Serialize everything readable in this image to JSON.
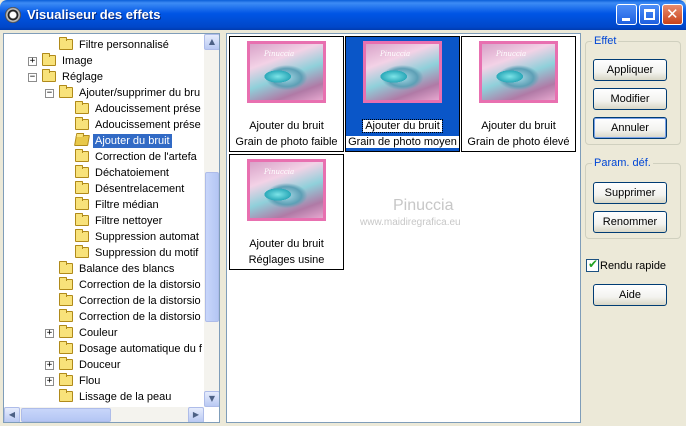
{
  "window": {
    "title": "Visualiseur des effets"
  },
  "tree": {
    "items": [
      {
        "label": "Filtre personnalisé",
        "level": 2,
        "expander": "",
        "open": false,
        "selected": false
      },
      {
        "label": "Image",
        "level": 1,
        "expander": "+",
        "open": false,
        "selected": false
      },
      {
        "label": "Réglage",
        "level": 1,
        "expander": "−",
        "open": true,
        "selected": false
      },
      {
        "label": "Ajouter/supprimer du bru",
        "level": 2,
        "expander": "−",
        "open": true,
        "selected": false
      },
      {
        "label": "Adoucissement prése",
        "level": 3,
        "expander": "",
        "open": false,
        "selected": false
      },
      {
        "label": "Adoucissement prése",
        "level": 3,
        "expander": "",
        "open": false,
        "selected": false
      },
      {
        "label": "Ajouter du bruit",
        "level": 3,
        "expander": "",
        "open": true,
        "selected": true
      },
      {
        "label": "Correction de l'artefa",
        "level": 3,
        "expander": "",
        "open": false,
        "selected": false
      },
      {
        "label": "Déchatoiement",
        "level": 3,
        "expander": "",
        "open": false,
        "selected": false
      },
      {
        "label": "Désentrelacement",
        "level": 3,
        "expander": "",
        "open": false,
        "selected": false
      },
      {
        "label": "Filtre médian",
        "level": 3,
        "expander": "",
        "open": false,
        "selected": false
      },
      {
        "label": "Filtre nettoyer",
        "level": 3,
        "expander": "",
        "open": false,
        "selected": false
      },
      {
        "label": "Suppression automat",
        "level": 3,
        "expander": "",
        "open": false,
        "selected": false
      },
      {
        "label": "Suppression du motif",
        "level": 3,
        "expander": "",
        "open": false,
        "selected": false
      },
      {
        "label": "Balance des blancs",
        "level": 2,
        "expander": "",
        "open": false,
        "selected": false
      },
      {
        "label": "Correction de la distorsio",
        "level": 2,
        "expander": "",
        "open": false,
        "selected": false
      },
      {
        "label": "Correction de la distorsio",
        "level": 2,
        "expander": "",
        "open": false,
        "selected": false
      },
      {
        "label": "Correction de la distorsio",
        "level": 2,
        "expander": "",
        "open": false,
        "selected": false
      },
      {
        "label": "Couleur",
        "level": 2,
        "expander": "+",
        "open": false,
        "selected": false
      },
      {
        "label": "Dosage automatique du f",
        "level": 2,
        "expander": "",
        "open": false,
        "selected": false
      },
      {
        "label": "Douceur",
        "level": 2,
        "expander": "+",
        "open": false,
        "selected": false
      },
      {
        "label": "Flou",
        "level": 2,
        "expander": "+",
        "open": false,
        "selected": false
      },
      {
        "label": "Lissage de la peau",
        "level": 2,
        "expander": "",
        "open": false,
        "selected": false
      }
    ]
  },
  "presets": [
    {
      "line1": "Ajouter du bruit",
      "line2": "Grain de photo faible",
      "selected": false,
      "thumb_caption": "Pinuccia"
    },
    {
      "line1": "Ajouter du bruit",
      "line2": "Grain de photo moyen",
      "selected": true,
      "thumb_caption": "Pinuccia"
    },
    {
      "line1": "Ajouter du bruit",
      "line2": "Grain de photo élevé",
      "selected": false,
      "thumb_caption": "Pinuccia"
    },
    {
      "line1": "Ajouter du bruit",
      "line2": "Réglages usine",
      "selected": false,
      "thumb_caption": "Pinuccia"
    }
  ],
  "watermark": {
    "name": "Pinuccia",
    "url": "www.maidiregrafica.eu"
  },
  "effet": {
    "legend": "Effet",
    "apply_label": "Appliquer",
    "edit_label": "Modifier",
    "cancel_label": "Annuler"
  },
  "params": {
    "legend": "Param. déf.",
    "delete_label": "Supprimer",
    "rename_label": "Renommer"
  },
  "quick_render": {
    "label": "Rendu rapide",
    "checked": true
  },
  "help_label": "Aide",
  "colors": {
    "titlebar": "#0055e5",
    "selection": "#316ac5",
    "preset_selected": "#0a56c8",
    "thumb_border": "#e870b0",
    "group_legend": "#0046d5"
  }
}
